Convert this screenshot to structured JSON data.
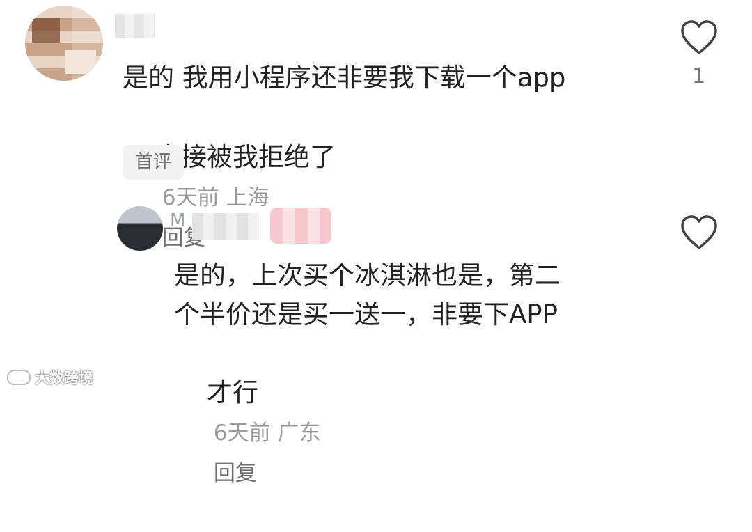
{
  "comments": [
    {
      "text_line1": "是的 我用小程序还非要我下载一个app",
      "text_line2": "直接被我拒绝了",
      "meta": "6天前 上海",
      "reply_label": "回复",
      "badge": "首评",
      "like_count": "1"
    },
    {
      "username_prefix": "M",
      "text_line1": "是的，上次买个冰淇淋也是，第二",
      "text_line2": "个半价还是买一送一，非要下APP",
      "text_line3": "才行",
      "meta": "6天前 广东",
      "reply_label": "回复"
    }
  ],
  "watermark": {
    "text": "大数跨境"
  },
  "icons": {
    "like": "heart-outline-icon"
  },
  "colors": {
    "text": "#222222",
    "meta": "#9a9a9a",
    "badge_bg": "#f2f2f2"
  }
}
